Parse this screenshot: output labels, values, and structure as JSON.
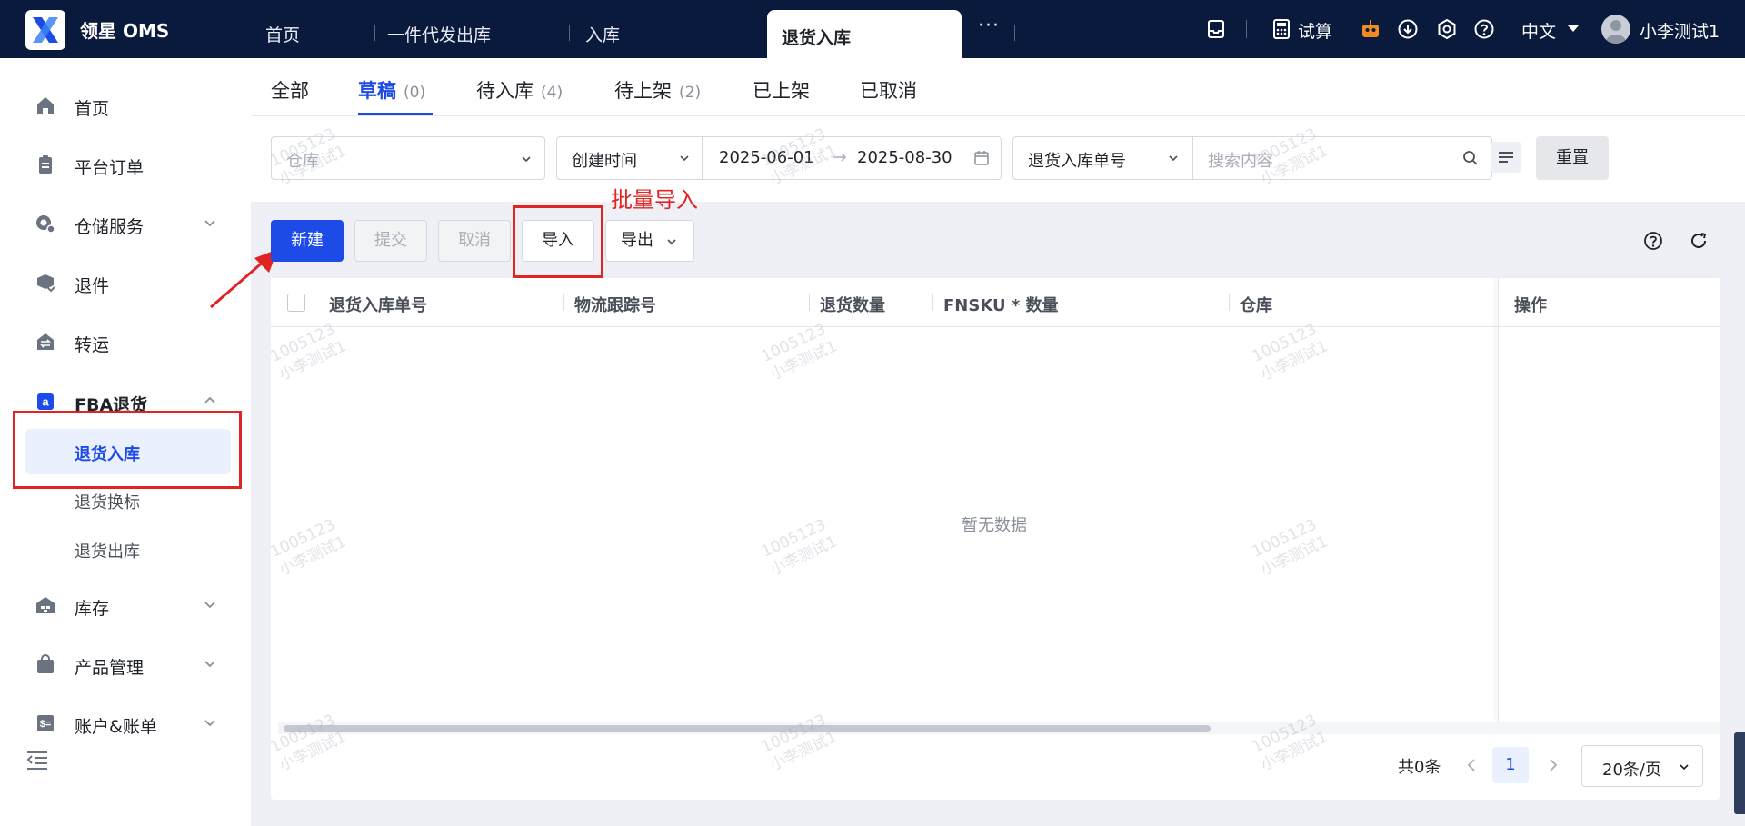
{
  "app": {
    "brand": "领星 OMS"
  },
  "top_tabs": [
    {
      "label": "首页"
    },
    {
      "label": "一件代发出库"
    },
    {
      "label": "入库"
    },
    {
      "label": "退货入库"
    }
  ],
  "top_right": {
    "calc_label": "试算",
    "lang": "中文",
    "user": "小李测试1"
  },
  "sidebar": {
    "items": [
      {
        "label": "首页"
      },
      {
        "label": "平台订单"
      },
      {
        "label": "仓储服务"
      },
      {
        "label": "退件"
      },
      {
        "label": "转运"
      },
      {
        "label": "FBA退货"
      },
      {
        "label": "库存"
      },
      {
        "label": "产品管理"
      },
      {
        "label": "账户&账单"
      }
    ],
    "fba_sub": [
      {
        "label": "退货入库"
      },
      {
        "label": "退货换标"
      },
      {
        "label": "退货出库"
      }
    ]
  },
  "status_tabs": [
    {
      "label": "全部",
      "count": ""
    },
    {
      "label": "草稿",
      "count": "(0)"
    },
    {
      "label": "待入库",
      "count": "(4)"
    },
    {
      "label": "待上架",
      "count": "(2)"
    },
    {
      "label": "已上架",
      "count": ""
    },
    {
      "label": "已取消",
      "count": ""
    }
  ],
  "filters": {
    "warehouse_placeholder": "仓库",
    "time_type": "创建时间",
    "date_start": "2025-06-01",
    "date_end": "2025-08-30",
    "search_type": "退货入库单号",
    "search_placeholder": "搜索内容",
    "reset_label": "重置"
  },
  "annotation": {
    "text": "批量导入"
  },
  "actions": {
    "new_label": "新建",
    "submit_label": "提交",
    "cancel_label": "取消",
    "import_label": "导入",
    "export_label": "导出"
  },
  "table": {
    "columns": [
      "退货入库单号",
      "物流跟踪号",
      "退货数量",
      "FNSKU * 数量",
      "仓库",
      "操作"
    ],
    "empty_text": "暂无数据"
  },
  "pagination": {
    "total": "共0条",
    "current_page": "1",
    "page_size": "20条/页"
  },
  "watermark": {
    "line1": "1005123",
    "line2": "小李测试1"
  },
  "colors": {
    "primary": "#1d4be8",
    "topbar": "#0a1a3c",
    "annotation": "#e02424"
  }
}
